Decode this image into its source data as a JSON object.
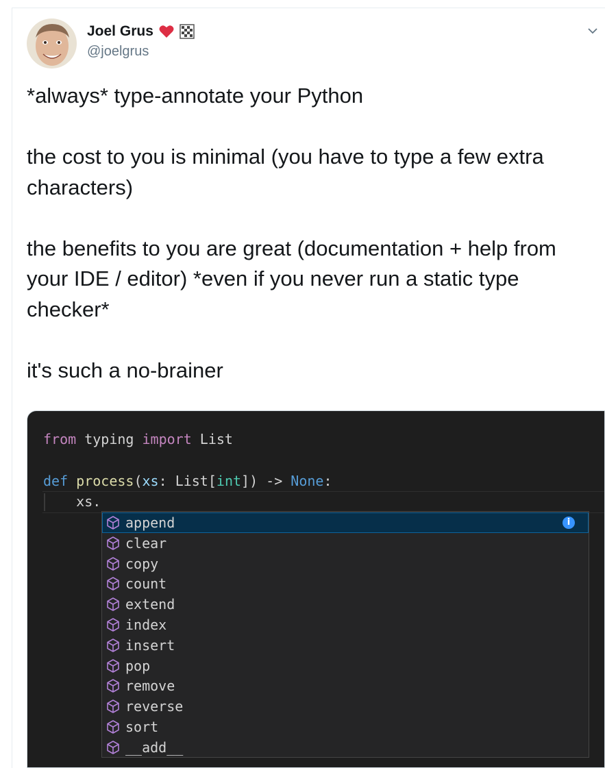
{
  "author": {
    "name": "Joel Grus",
    "handle": "@joelgrus",
    "emoji_icons": [
      "heart-icon",
      "checkered-flag-badge-icon"
    ]
  },
  "tweet": {
    "paragraphs": [
      "*always* type-annotate your Python",
      "the cost to you is minimal (you have to type a few extra characters)",
      "the benefits to you are great (documentation + help from your IDE / editor) *even if you never run a static type checker*",
      "it's such a no-brainer"
    ]
  },
  "code": {
    "line1": {
      "from": "from",
      "module": " typing ",
      "import": "import",
      "name": " List"
    },
    "line3": {
      "def": "def",
      "fn": " process",
      "open": "(",
      "param": "xs",
      "colon": ": ",
      "type": "List",
      "lb": "[",
      "int": "int",
      "rb": "])",
      "arrow": " -> ",
      "none": "None",
      "end": ":"
    },
    "line4": "    xs.",
    "suggestions": [
      "append",
      "clear",
      "copy",
      "count",
      "extend",
      "index",
      "insert",
      "pop",
      "remove",
      "reverse",
      "sort",
      "__add__"
    ],
    "selected_index": 0,
    "info_label": "i"
  },
  "colors": {
    "editor_bg": "#1e1e1e",
    "keyword": "#c586c0",
    "keyword_blue": "#569cd6",
    "function": "#dcdcaa",
    "selection": "#062f4a",
    "method_icon": "#b180d7"
  }
}
